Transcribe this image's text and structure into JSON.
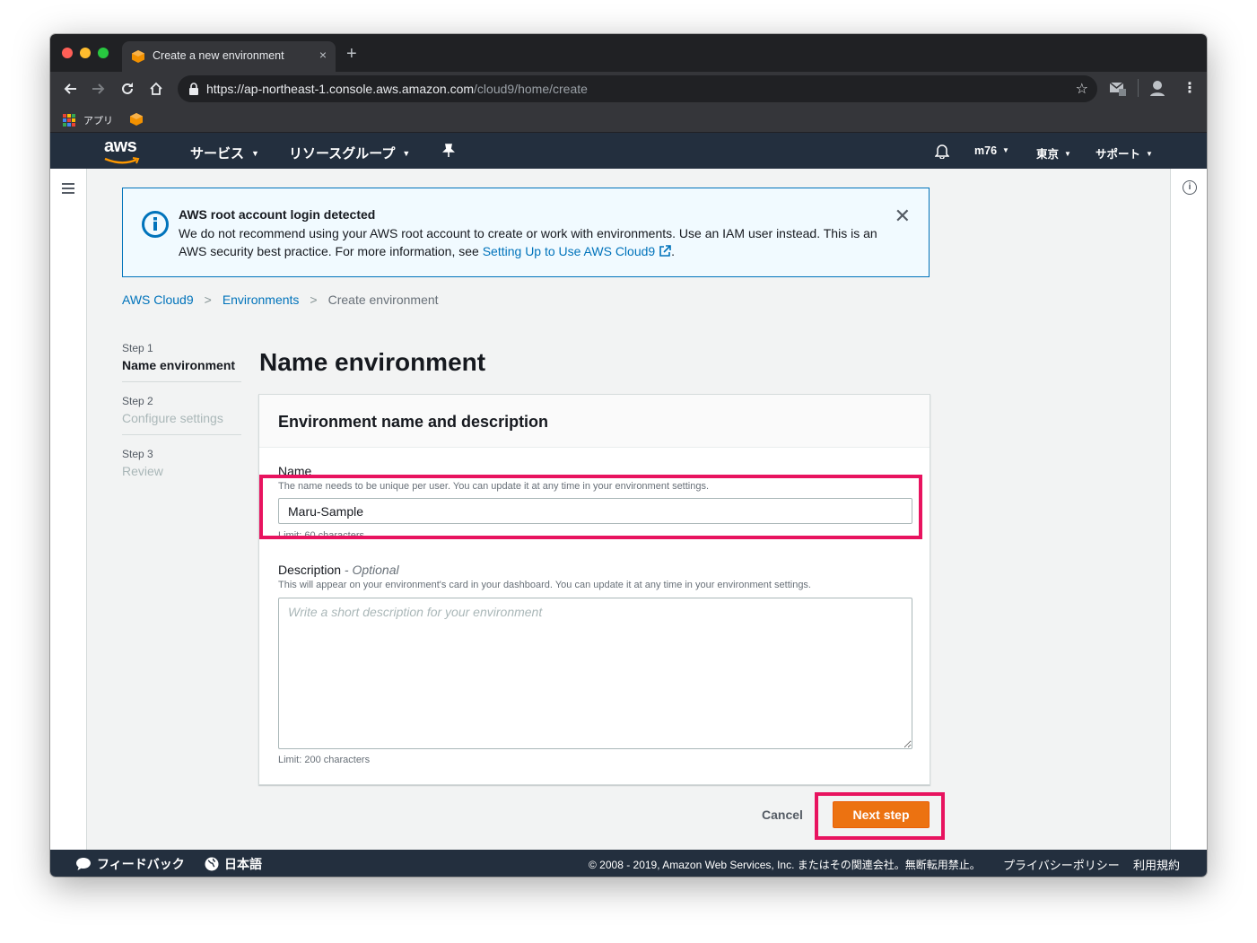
{
  "browser": {
    "tab_title": "Create a new environment",
    "tab_close": "×",
    "new_tab": "+",
    "url_host": "https://ap-northeast-1.console.aws.amazon.com",
    "url_path": "/cloud9/home/create",
    "bookmarks_apps_label": "アプリ"
  },
  "aws_nav": {
    "logo": "aws",
    "services": "サービス",
    "resource_groups": "リソースグループ",
    "account": "m76",
    "region": "東京",
    "support": "サポート"
  },
  "alert": {
    "title": "AWS root account login detected",
    "body": "We do not recommend using your AWS root account to create or work with environments. Use an IAM user instead. This is an AWS security best practice. For more information, see ",
    "link": "Setting Up to Use AWS Cloud9",
    "period": "."
  },
  "breadcrumb": {
    "items": [
      "AWS Cloud9",
      "Environments",
      "Create environment"
    ]
  },
  "steps": [
    {
      "num": "Step 1",
      "label": "Name environment"
    },
    {
      "num": "Step 2",
      "label": "Configure settings"
    },
    {
      "num": "Step 3",
      "label": "Review"
    }
  ],
  "page": {
    "title": "Name environment"
  },
  "panel": {
    "title": "Environment name and description",
    "name_label": "Name",
    "name_desc": "The name needs to be unique per user. You can update it at any time in your environment settings.",
    "name_value": "Maru-Sample",
    "name_limit": "Limit: 60 characters",
    "desc_label": "Description",
    "desc_optional": " - Optional",
    "desc_desc": "This will appear on your environment's card in your dashboard. You can update it at any time in your environment settings.",
    "desc_placeholder": "Write a short description for your environment",
    "desc_limit": "Limit: 200 characters"
  },
  "actions": {
    "cancel": "Cancel",
    "next": "Next step"
  },
  "footer": {
    "feedback": "フィードバック",
    "language": "日本語",
    "copyright": "© 2008 - 2019, Amazon Web Services, Inc. またはその関連会社。無断転用禁止。",
    "privacy": "プライバシーポリシー",
    "terms": "利用規約"
  },
  "colors": {
    "aws_orange": "#ec7211",
    "aws_navy": "#232f3e",
    "link_blue": "#0073bb",
    "highlight": "#e8135f"
  }
}
